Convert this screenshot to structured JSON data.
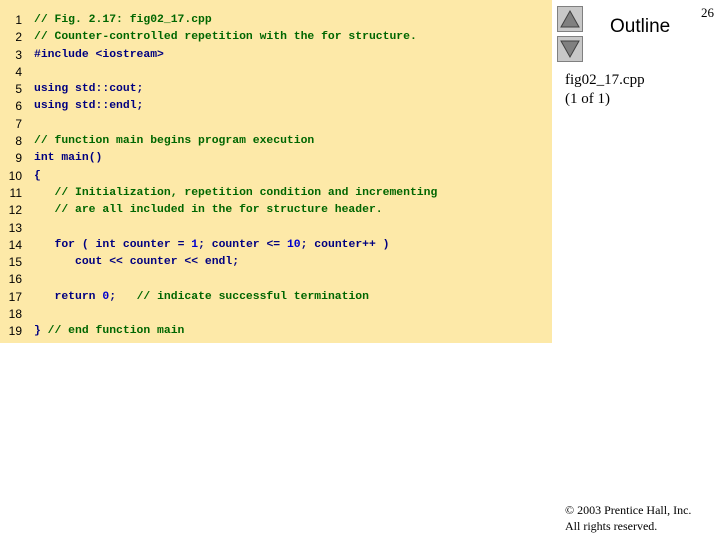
{
  "slide": {
    "number": "26",
    "outline_label": "Outline",
    "file_name": "fig02_17.cpp",
    "page_info": "(1 of 1)",
    "copyright_line1": "© 2003 Prentice Hall, Inc.",
    "copyright_line2": "All rights reserved."
  },
  "navigation": {
    "up_icon": "triangle-up-icon",
    "down_icon": "triangle-down-icon"
  },
  "colors": {
    "code_background": "#fde9a8",
    "comment": "#006600",
    "keyword": "#000080",
    "number": "#0000cc"
  },
  "code": {
    "line_numbers": [
      "1",
      "2",
      "3",
      "4",
      "5",
      "6",
      "7",
      "8",
      "9",
      "10",
      "11",
      "12",
      "13",
      "14",
      "15",
      "16",
      "17",
      "18",
      "19"
    ],
    "lines": [
      [
        {
          "t": "// Fig. 2.17: fig02_17.cpp",
          "c": "c"
        }
      ],
      [
        {
          "t": "// Counter-controlled repetition with the for structure.",
          "c": "c"
        }
      ],
      [
        {
          "t": "#include <iostream>",
          "c": "t"
        }
      ],
      [],
      [
        {
          "t": "using std::cout;",
          "c": "t"
        }
      ],
      [
        {
          "t": "using std::endl;",
          "c": "t"
        }
      ],
      [],
      [
        {
          "t": "// function main begins program execution",
          "c": "c"
        }
      ],
      [
        {
          "t": "int",
          "c": "k"
        },
        {
          "t": " main()",
          "c": "t"
        }
      ],
      [
        {
          "t": "{",
          "c": "t"
        }
      ],
      [
        {
          "t": "   // Initialization, repetition condition and incrementing",
          "c": "c"
        }
      ],
      [
        {
          "t": "   // are all included in the for structure header.",
          "c": "c"
        }
      ],
      [],
      [
        {
          "t": "   for",
          "c": "k"
        },
        {
          "t": " ( ",
          "c": "t"
        },
        {
          "t": "int",
          "c": "k"
        },
        {
          "t": " counter = ",
          "c": "t"
        },
        {
          "t": "1",
          "c": "n"
        },
        {
          "t": "; counter <= ",
          "c": "t"
        },
        {
          "t": "10",
          "c": "n"
        },
        {
          "t": "; counter++ )",
          "c": "t"
        }
      ],
      [
        {
          "t": "      cout << counter << endl;",
          "c": "t"
        }
      ],
      [],
      [
        {
          "t": "   return",
          "c": "k"
        },
        {
          "t": " ",
          "c": "t"
        },
        {
          "t": "0",
          "c": "n"
        },
        {
          "t": ";   ",
          "c": "t"
        },
        {
          "t": "// indicate successful termination",
          "c": "c"
        }
      ],
      [],
      [
        {
          "t": "} ",
          "c": "t"
        },
        {
          "t": "// end function main",
          "c": "c"
        }
      ]
    ]
  }
}
